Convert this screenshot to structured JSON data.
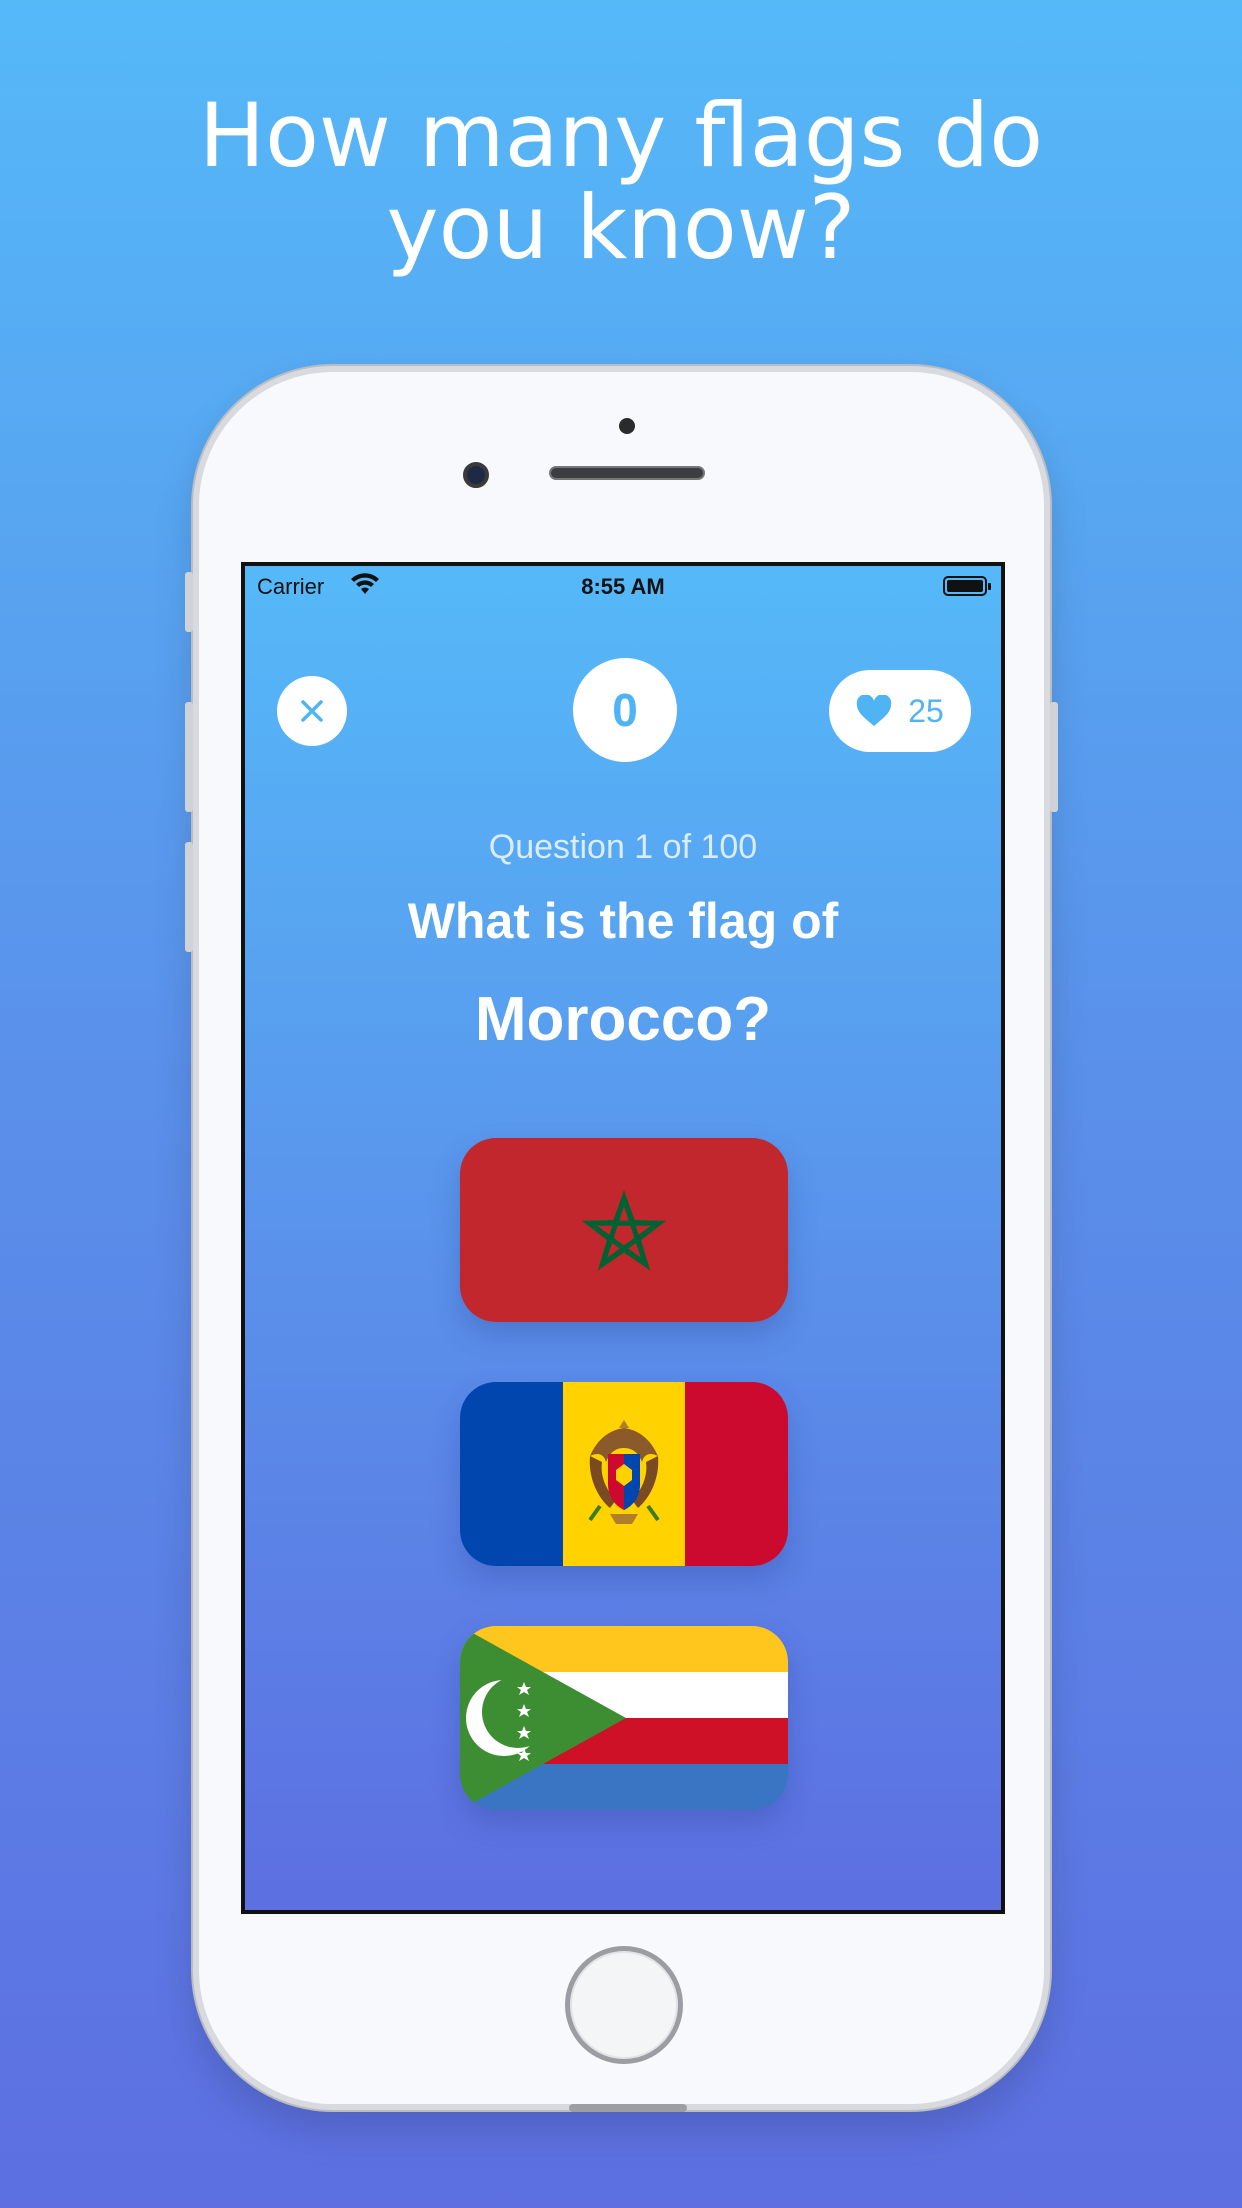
{
  "headline": {
    "line1": "How many flags do",
    "line2": "you know?"
  },
  "statusbar": {
    "carrier": "Carrier",
    "time": "8:55 AM",
    "wifi_icon": "wifi-icon",
    "battery_icon": "battery-icon"
  },
  "game": {
    "close_icon": "close-icon",
    "score": "0",
    "lives": "25",
    "lives_icon": "heart-icon",
    "progress": "Question 1 of 100",
    "question": "What is the flag of",
    "country": "Morocco?"
  },
  "options": [
    {
      "flag": "Morocco",
      "colors": {
        "field": "#c1272d",
        "star": "#006233"
      }
    },
    {
      "flag": "Moldova",
      "colors": {
        "blue": "#0046ae",
        "yellow": "#ffd200",
        "red": "#cc092f"
      }
    },
    {
      "flag": "Comoros",
      "colors": {
        "yellow": "#ffc61e",
        "white": "#ffffff",
        "red": "#ce1126",
        "blue": "#3a75c4",
        "green": "#3d8e33"
      }
    }
  ],
  "colors": {
    "accent": "#4fb4f4",
    "background_top": "#55b9f8",
    "background_bottom": "#5d6fe1"
  }
}
